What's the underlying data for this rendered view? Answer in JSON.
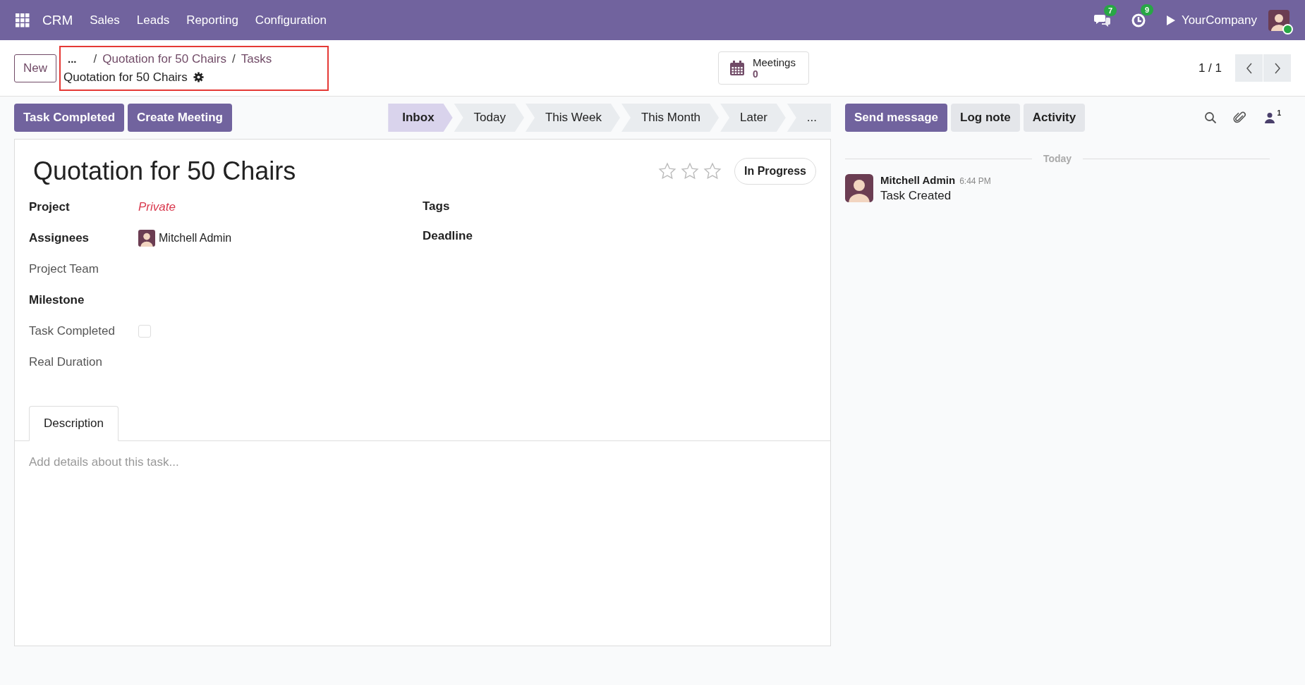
{
  "navbar": {
    "app": "CRM",
    "menu": [
      "Sales",
      "Leads",
      "Reporting",
      "Configuration"
    ],
    "messages_count": "7",
    "activities_count": "9",
    "company": "YourCompany",
    "online": true
  },
  "control_panel": {
    "new_button": "New",
    "breadcrumb": {
      "ellipsis": "...",
      "separator": "/",
      "items": [
        "Quotation for 50 Chairs",
        "Tasks"
      ],
      "current": "Quotation for 50 Chairs"
    },
    "highlighted": true,
    "smart_button": {
      "label": "Meetings",
      "count": "0"
    },
    "pager": "1 / 1"
  },
  "actions": [
    "Task Completed",
    "Create Meeting"
  ],
  "stages": [
    {
      "label": "Inbox",
      "selected": true
    },
    {
      "label": "Today",
      "selected": false
    },
    {
      "label": "This Week",
      "selected": false
    },
    {
      "label": "This Month",
      "selected": false
    },
    {
      "label": "Later",
      "selected": false
    },
    {
      "label": "...",
      "selected": false
    }
  ],
  "form": {
    "title": "Quotation for 50 Chairs",
    "stars": 0,
    "state": "In Progress",
    "left_fields": [
      {
        "label": "Project",
        "kind": "private",
        "value": "Private",
        "bold": true
      },
      {
        "label": "Assignees",
        "kind": "user",
        "value": "Mitchell Admin",
        "bold": true
      },
      {
        "label": "Project Team",
        "kind": "empty",
        "bold": false
      },
      {
        "label": "Milestone",
        "kind": "empty",
        "bold": true
      },
      {
        "label": "Task Completed",
        "kind": "checkbox",
        "checked": false,
        "bold": false
      },
      {
        "label": "Real Duration",
        "kind": "empty",
        "bold": false
      }
    ],
    "right_fields": [
      {
        "label": "Tags"
      },
      {
        "label": "Deadline"
      }
    ],
    "tabs": [
      {
        "label": "Description",
        "selected": true
      }
    ],
    "description": {
      "placeholder": "Add details about this task..."
    }
  },
  "chatter": {
    "buttons": [
      {
        "label": "Send message",
        "selected": true
      },
      {
        "label": "Log note",
        "selected": false
      },
      {
        "label": "Activity",
        "selected": false
      }
    ],
    "followers": "1",
    "date_separator": "Today",
    "messages": [
      {
        "author": "Mitchell Admin",
        "time": "6:44 PM",
        "body": "Task Created"
      }
    ]
  }
}
